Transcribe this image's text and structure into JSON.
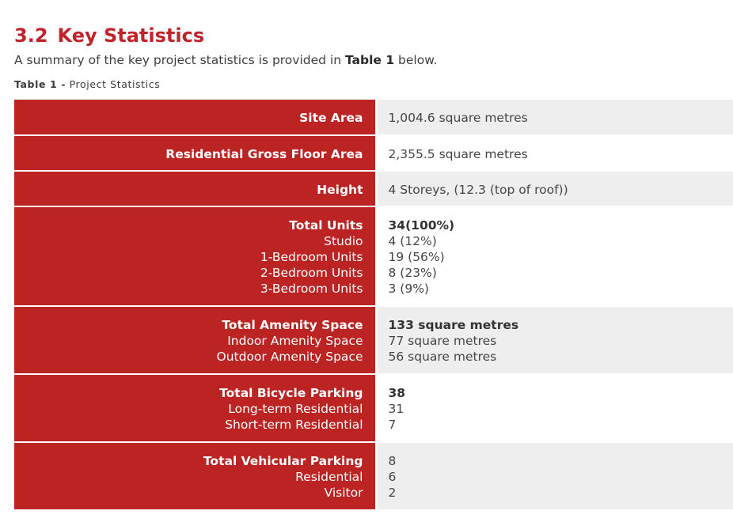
{
  "section": {
    "number": "3.2",
    "title": "Key Statistics"
  },
  "intro": {
    "prefix": "A summary of the key project statistics is provided in ",
    "ref": "Table 1",
    "suffix": " below."
  },
  "caption": {
    "label": "Table 1 -",
    "text": "Project Statistics"
  },
  "table": {
    "rows": [
      {
        "label": "Site Area",
        "value": "1,004.6 square metres"
      },
      {
        "label": "Residential Gross Floor Area",
        "value": "2,355.5 square metres"
      },
      {
        "label": "Height",
        "value": "4 Storeys, (12.3 (top of roof))"
      },
      {
        "label": "Total Units",
        "value": "34(100%)",
        "sub": [
          [
            "Studio",
            "4 (12%)"
          ],
          [
            "1-Bedroom Units",
            "19 (56%)"
          ],
          [
            "2-Bedroom Units",
            "8 (23%)"
          ],
          [
            "3-Bedroom Units",
            "3 (9%)"
          ]
        ]
      },
      {
        "label": "Total Amenity Space",
        "value": "133 square metres",
        "sub": [
          [
            "Indoor Amenity Space",
            "77 square metres"
          ],
          [
            "Outdoor Amenity Space",
            "56 square metres"
          ]
        ]
      },
      {
        "label": "Total Bicycle Parking",
        "value": "38",
        "sub": [
          [
            "Long-term Residential",
            "31"
          ],
          [
            "Short-term Residential",
            "7"
          ]
        ]
      },
      {
        "label": "Total Vehicular Parking",
        "value": "8",
        "sub": [
          [
            "Residential",
            "6"
          ],
          [
            "Visitor",
            "2"
          ]
        ]
      }
    ]
  }
}
